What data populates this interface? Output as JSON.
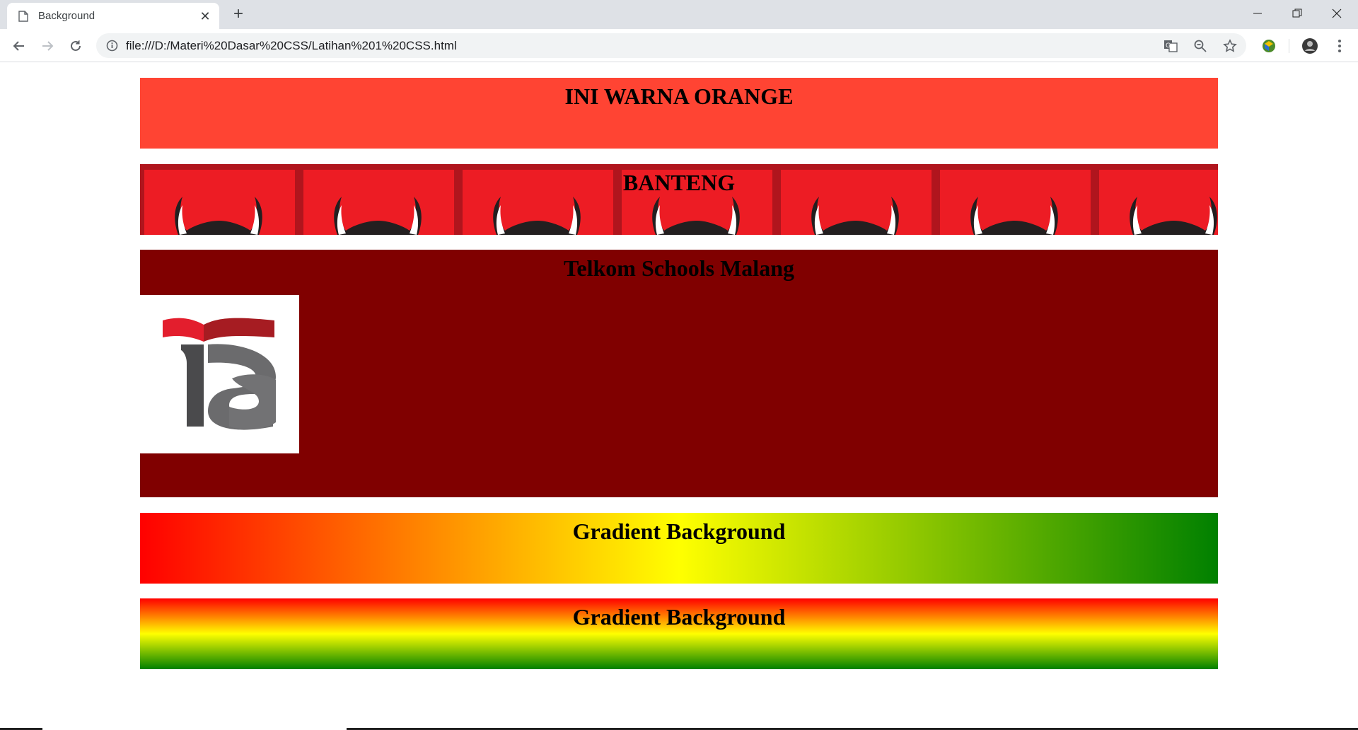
{
  "browser": {
    "tab_title": "Background",
    "url": "file:///D:/Materi%20Dasar%20CSS/Latihan%201%20CSS.html"
  },
  "page": {
    "boxes": [
      {
        "title": "INI WARNA ORANGE",
        "background": "#ff4433"
      },
      {
        "title": "BANTENG",
        "background": "#ed1c24"
      },
      {
        "title": "Telkom Schools Malang",
        "background": "#800000"
      },
      {
        "title": "Gradient Background",
        "background": "linear-gradient(to right, red, yellow, green)"
      },
      {
        "title": "Gradient Background",
        "background": "linear-gradient(to bottom, red, yellow, green)"
      }
    ]
  },
  "icons": {
    "tab": "page-icon",
    "close": "close-icon",
    "new_tab": "plus-icon",
    "back": "back-arrow-icon",
    "forward": "forward-arrow-icon",
    "reload": "reload-icon",
    "info": "info-icon",
    "translate": "translate-icon",
    "zoom": "zoom-out-icon",
    "bookmark": "star-icon",
    "extension": "extension-icon",
    "profile": "avatar-icon",
    "menu": "kebab-menu-icon"
  }
}
